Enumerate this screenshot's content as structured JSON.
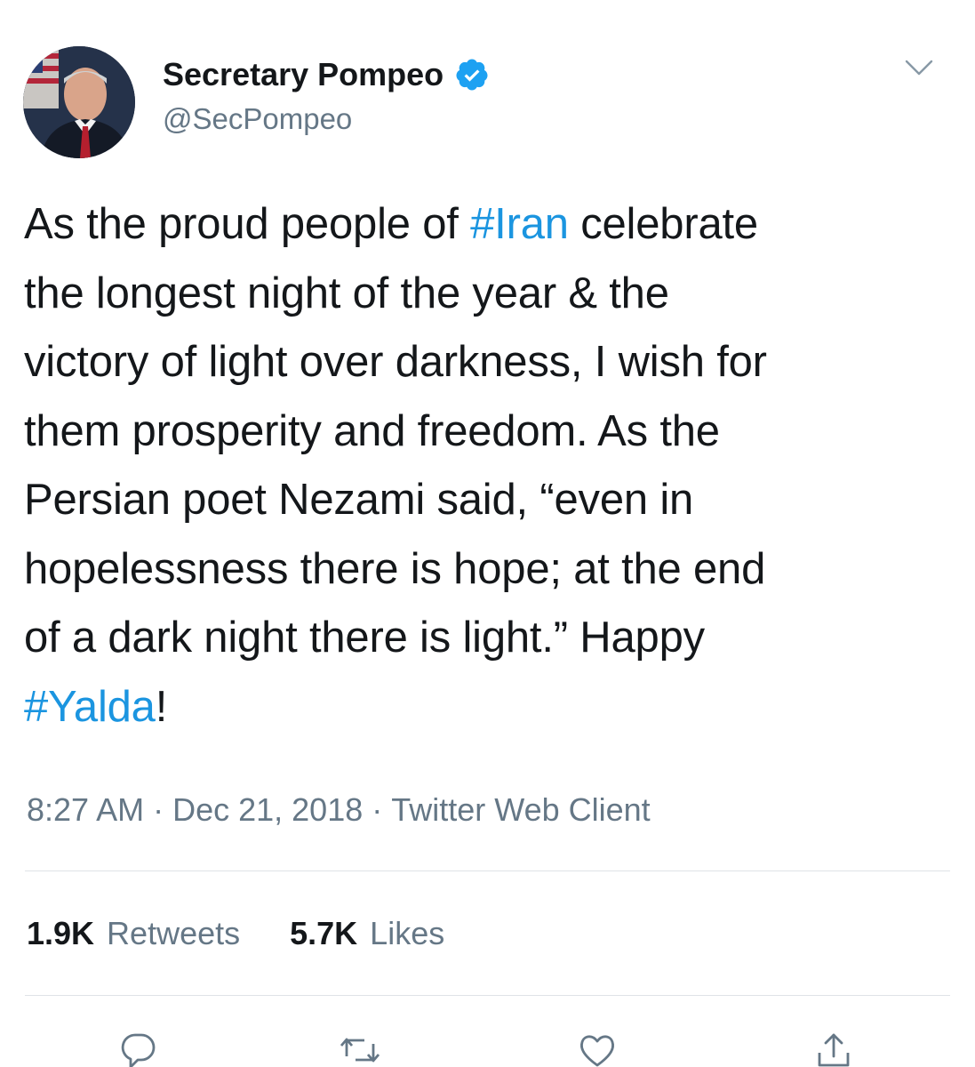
{
  "author": {
    "display_name": "Secretary Pompeo",
    "handle": "@SecPompeo",
    "verified": true,
    "avatar_icon": "profile-photo"
  },
  "tweet": {
    "lines": [
      [
        {
          "text": "As the proud people of "
        },
        {
          "text": "#Iran",
          "hashtag": true
        },
        {
          "text": " celebrate"
        }
      ],
      [
        {
          "text": "the longest night of the year & the"
        }
      ],
      [
        {
          "text": "victory of light over darkness, I wish for"
        }
      ],
      [
        {
          "text": "them prosperity and freedom. As the"
        }
      ],
      [
        {
          "text": "Persian poet Nezami said, “even in"
        }
      ],
      [
        {
          "text": "hopelessness there is hope; at the end"
        }
      ],
      [
        {
          "text": "of a dark night there is light.” Happy"
        }
      ],
      [
        {
          "text": "#Yalda",
          "hashtag": true
        },
        {
          "text": "!"
        }
      ]
    ]
  },
  "meta": {
    "time": "8:27 AM",
    "separator": "·",
    "date": "Dec 21, 2018",
    "client": "Twitter Web Client"
  },
  "stats": {
    "retweets_count": "1.9K",
    "retweets_label": "Retweets",
    "likes_count": "5.7K",
    "likes_label": "Likes"
  },
  "actions": [
    "reply-icon",
    "retweet-icon",
    "like-icon",
    "share-icon"
  ],
  "colors": {
    "text": "#14171a",
    "secondary": "#657786",
    "link": "#1b95e0",
    "divider": "#dfe3e7"
  }
}
